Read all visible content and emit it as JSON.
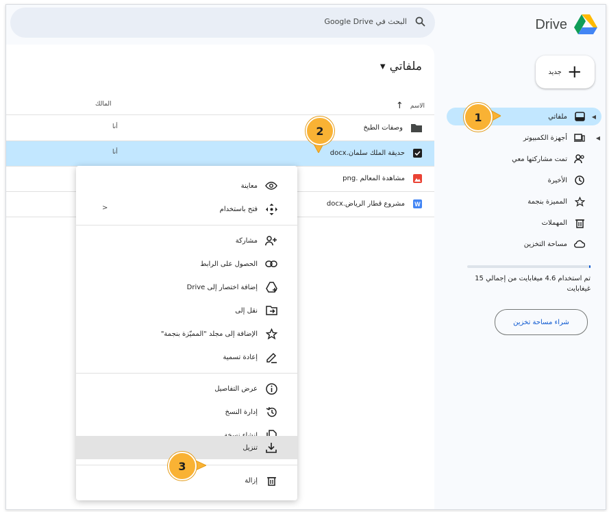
{
  "brand": {
    "name": "Drive"
  },
  "sidebar": {
    "new_label": "جديد",
    "items": [
      {
        "label": "ملفاتي",
        "icon": "my-drive-icon",
        "active": true
      },
      {
        "label": "أجهزة الكمبيوتر",
        "icon": "computers-icon"
      },
      {
        "label": "تمت مشاركتها معي",
        "icon": "shared-icon"
      },
      {
        "label": "الأخيرة",
        "icon": "clock-icon"
      },
      {
        "label": "المميزة بنجمة",
        "icon": "star-icon"
      },
      {
        "label": "المهملات",
        "icon": "trash-icon"
      },
      {
        "label": "مساحة التخزين",
        "icon": "cloud-icon"
      }
    ],
    "storage_text": "تم استخدام 4.6 ميغابايت من إجمالي 15 غيغابايت",
    "storage_used_fraction": 0.0003,
    "buy_storage": "شراء مساحة تخزين"
  },
  "search": {
    "placeholder": "البحث في Google Drive"
  },
  "main": {
    "title": "ملفاتي",
    "col_name": "الاسم",
    "col_owner": "المالك",
    "files": [
      {
        "name": "وصفات الطبخ",
        "type": "folder",
        "owner": "أنا"
      },
      {
        "name": "حديقة الملك سلمان.docx",
        "type": "selected",
        "owner": "أنا"
      },
      {
        "name": "مشاهدة المعالم .png",
        "type": "image",
        "owner": ""
      },
      {
        "name": "مشروع قطار الرياض.docx",
        "type": "word",
        "owner": ""
      }
    ]
  },
  "context_menu": {
    "items": [
      {
        "label": "معاينة",
        "icon": "eye-icon"
      },
      {
        "label": "فتح باستخدام",
        "icon": "open-with-icon",
        "submenu": "<"
      },
      {
        "label": "مشاركة",
        "icon": "share-person-icon"
      },
      {
        "label": "الحصول على الرابط",
        "icon": "link-icon"
      },
      {
        "label": "إضافة اختصار إلى Drive",
        "icon": "add-shortcut-icon"
      },
      {
        "label": "نقل إلى",
        "icon": "move-to-icon"
      },
      {
        "label": "الإضافة إلى مجلد \"المميّزة بنجمة\"",
        "icon": "star-icon"
      },
      {
        "label": "إعادة تسمية",
        "icon": "rename-icon"
      },
      {
        "label": "عرض التفاصيل",
        "icon": "info-icon"
      },
      {
        "label": "إدارة النسخ",
        "icon": "history-icon"
      },
      {
        "label": "إنشاء نسخة",
        "icon": "copy-icon"
      },
      {
        "label": "تنزيل",
        "icon": "download-icon"
      },
      {
        "label": "إزالة",
        "icon": "trash-icon"
      }
    ]
  },
  "callouts": [
    "1",
    "2",
    "3"
  ],
  "colors": {
    "accent": "#c2e7ff",
    "badge": "#f9b234",
    "link": "#0b57d0"
  }
}
